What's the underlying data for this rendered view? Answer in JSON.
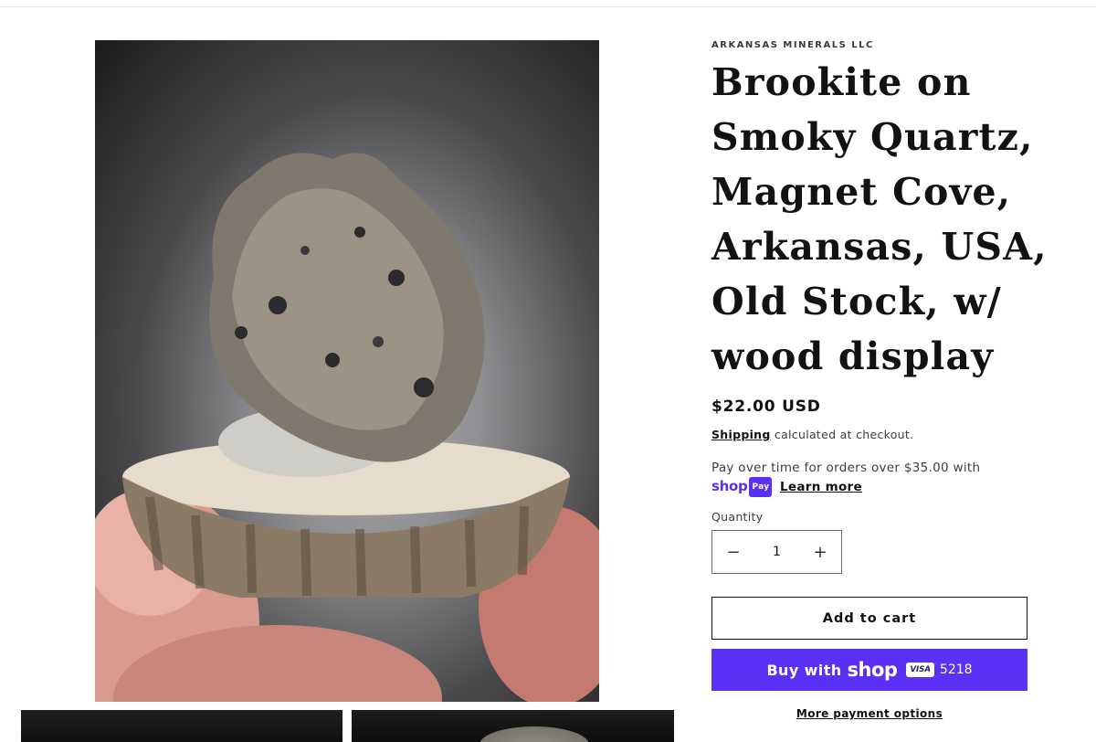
{
  "product": {
    "vendor": "ARKANSAS MINERALS LLC",
    "title_lines": [
      "Brookite on",
      "Smoky Quartz,",
      "Magnet Cove,",
      "Arkansas, USA,",
      "Old Stock, w/",
      "wood display"
    ],
    "price": "$22.00 USD",
    "shipping_link": "Shipping",
    "shipping_rest": " calculated at checkout.",
    "installments_text": "Pay over time for orders over $35.00 with",
    "shop_logo": "shop",
    "pay_badge": "Pay",
    "learn_more": "Learn more"
  },
  "quantity": {
    "label": "Quantity",
    "value": "1",
    "minus": "−",
    "plus": "+"
  },
  "buttons": {
    "add_to_cart": "Add to cart",
    "buy_with": "Buy with",
    "shop_word": "shop",
    "card_brand": "VISA",
    "card_digits": "5218",
    "more_payment": "More payment options"
  },
  "colors": {
    "accent": "#5a31f4",
    "text": "#121212"
  },
  "icons": [
    "minus-icon",
    "plus-icon",
    "shop-pay-logo",
    "visa-card-icon"
  ]
}
